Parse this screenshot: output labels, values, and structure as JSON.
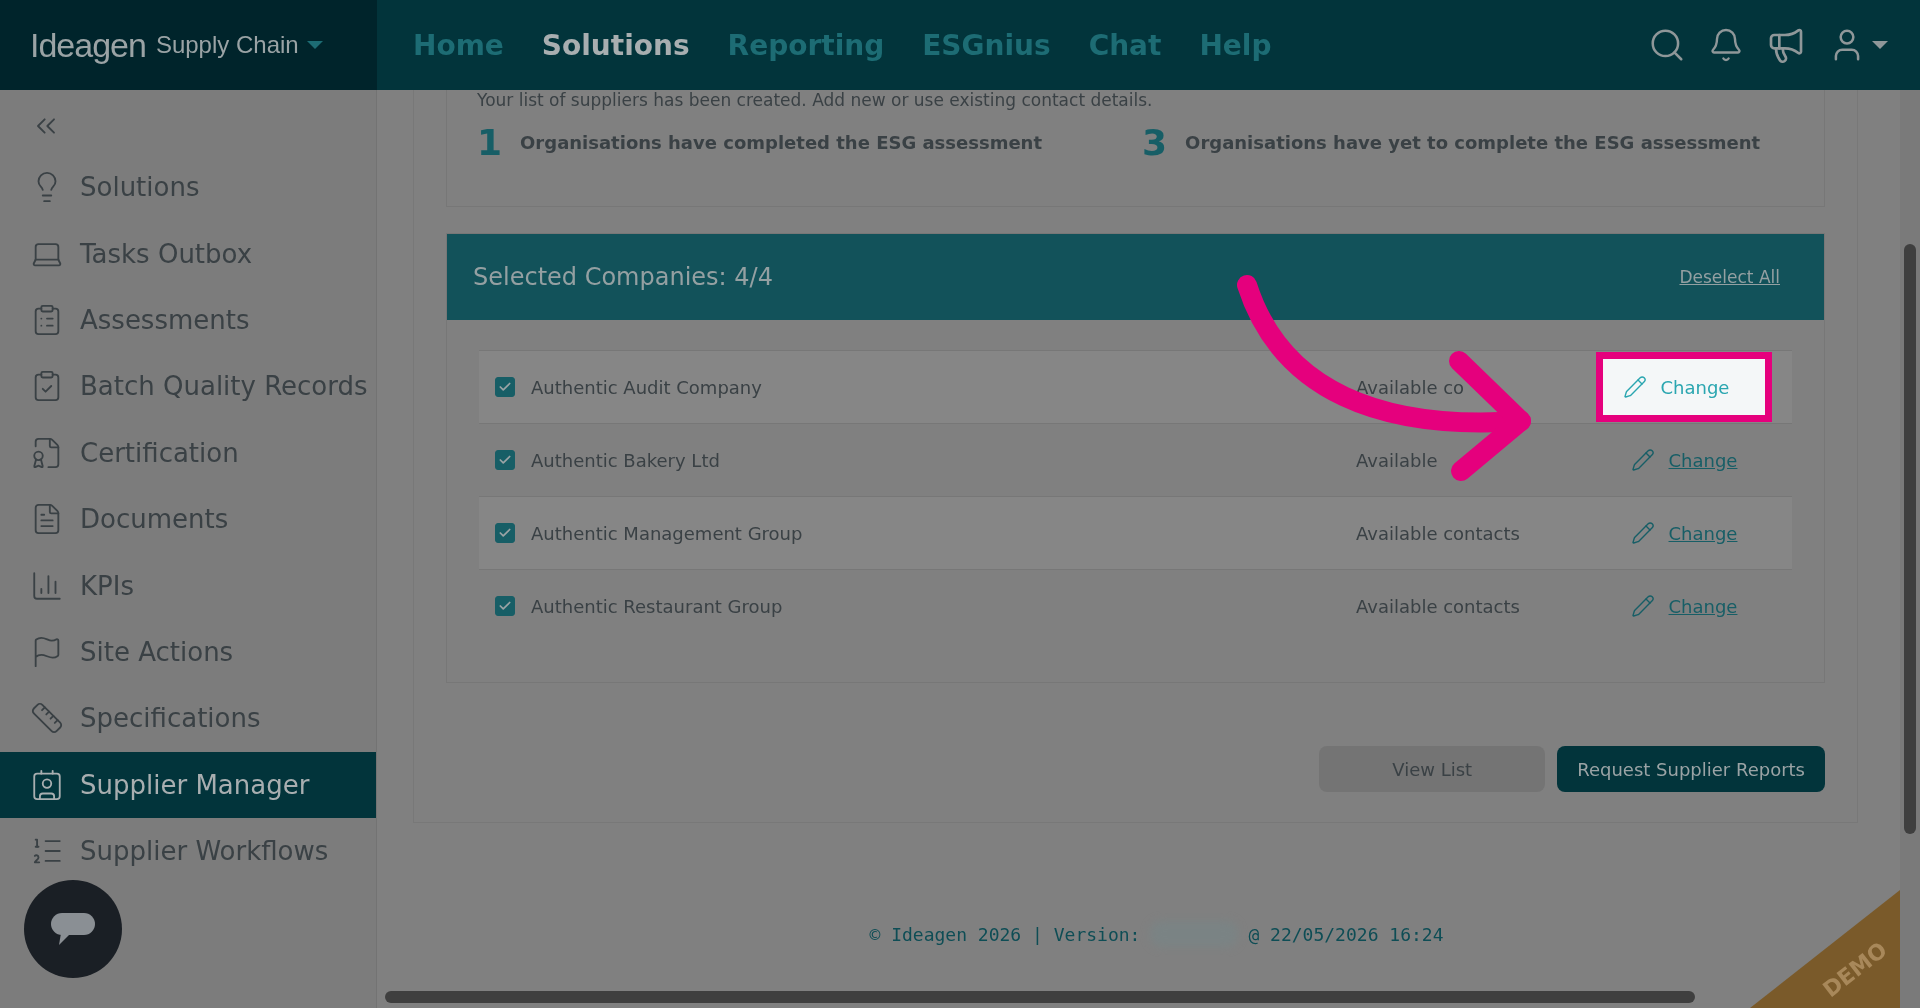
{
  "header": {
    "logo": "Ideagen",
    "product": "Supply Chain",
    "nav": [
      {
        "label": "Home",
        "selected": false
      },
      {
        "label": "Solutions",
        "selected": true
      },
      {
        "label": "Reporting",
        "selected": false
      },
      {
        "label": "ESGnius",
        "selected": false
      },
      {
        "label": "Chat",
        "selected": false
      },
      {
        "label": "Help",
        "selected": false
      }
    ]
  },
  "sidebar": {
    "items": [
      {
        "label": "Solutions",
        "selected": false
      },
      {
        "label": "Tasks Outbox",
        "selected": false
      },
      {
        "label": "Assessments",
        "selected": false
      },
      {
        "label": "Batch Quality Records",
        "selected": false
      },
      {
        "label": "Certification",
        "selected": false
      },
      {
        "label": "Documents",
        "selected": false
      },
      {
        "label": "KPIs",
        "selected": false
      },
      {
        "label": "Site Actions",
        "selected": false
      },
      {
        "label": "Specifications",
        "selected": false
      },
      {
        "label": "Supplier Manager",
        "selected": true
      },
      {
        "label": "Supplier Workflows",
        "selected": false
      }
    ]
  },
  "intro": "Your list of suppliers has been created. Add new or use existing contact details.",
  "stats": [
    {
      "count": "1",
      "label": "Organisations have completed the ESG assessment"
    },
    {
      "count": "3",
      "label": "Organisations have yet to complete the ESG assessment"
    }
  ],
  "selection": {
    "title": "Selected Companies: 4/4",
    "deselect": "Deselect All",
    "rows": [
      {
        "name": "Authentic Audit Company",
        "checked": true,
        "contacts": "Available co",
        "action": "Change",
        "highlighted": true
      },
      {
        "name": "Authentic Bakery Ltd",
        "checked": true,
        "contacts": "Available",
        "action": "Change",
        "highlighted": false
      },
      {
        "name": "Authentic Management Group",
        "checked": true,
        "contacts": "Available contacts",
        "action": "Change",
        "highlighted": false
      },
      {
        "name": "Authentic Restaurant Group",
        "checked": true,
        "contacts": "Available contacts",
        "action": "Change",
        "highlighted": false
      }
    ]
  },
  "buttons": [
    {
      "label": "View List",
      "kind": "secondary"
    },
    {
      "label": "Request Supplier Reports",
      "kind": "primary"
    }
  ],
  "footer": {
    "copyright": "© Ideagen 2026 | Version:",
    "timestamp": "@ 22/05/2026 16:24"
  },
  "ribbon": "DEMO"
}
